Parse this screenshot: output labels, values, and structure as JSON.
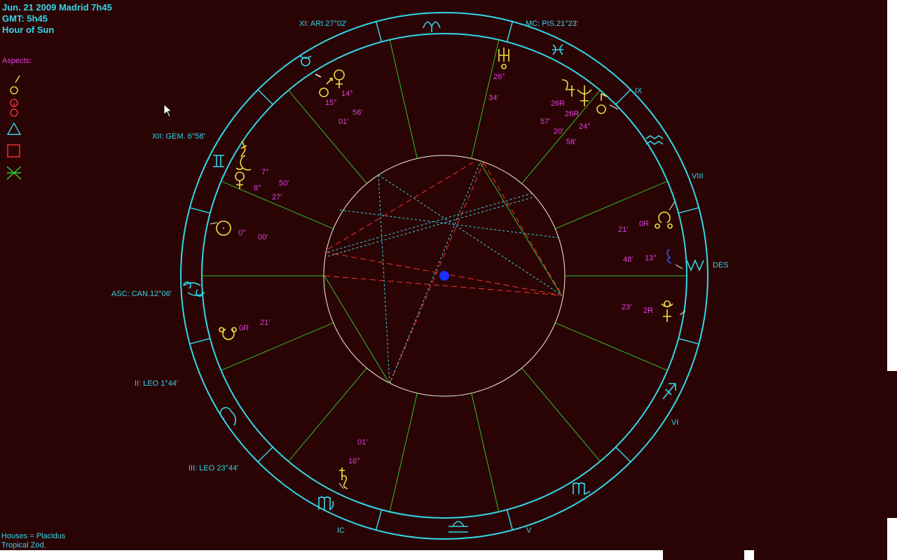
{
  "header": {
    "line1": "Jun. 21 2009 Madrid  7h45",
    "line2": "GMT: 5h45",
    "line3": "Hour of Sun"
  },
  "aspects": {
    "title": "Aspects:",
    "items": [
      {
        "name": "conjunction",
        "color": "#f0e040"
      },
      {
        "name": "opposition",
        "color": "#ff3030"
      },
      {
        "name": "trine",
        "color": "#33d6ea"
      },
      {
        "name": "square",
        "color": "#ff3030"
      },
      {
        "name": "sextile",
        "color": "#30d030"
      }
    ]
  },
  "footer": {
    "houses": "Houses = Placidus",
    "zodiac": "Tropical Zod."
  },
  "colors": {
    "background": "#2a0404",
    "wheel": "#33d6ea",
    "house_lines": "#2fc02f",
    "inner_circle": "#f2f2e0",
    "planet": "#f0e040",
    "degree_text": "#e040e0",
    "opposition": "#ff3030",
    "trine": "#33d6ea",
    "center_dot": "#1830ff",
    "moon_node_blue": "#3050ff"
  },
  "house_cusps": {
    "xi": "XI: ARI.27°02'",
    "mc": "MC: PIS.21°23'",
    "xii": "XII: GEM. 6°58'",
    "asc": "ASC: CAN.12°06'",
    "ii": "II: LEO  1°44'",
    "iii": "III: LEO 23°44'",
    "ic": "IC",
    "v": "V",
    "vi": "VI",
    "des": "DES",
    "viii": "VIII",
    "ix": "IX"
  },
  "degrees": {
    "mars_deg": "15°",
    "mars_min": "01'",
    "venus_deg": "14°",
    "venus_min": "56'",
    "uranus_deg": "26°",
    "uranus_min": "34'",
    "jupiter_deg": "26R",
    "jupiter_min": "57'",
    "neptune_deg": "26R",
    "neptune_min": "20'",
    "chiron_deg": "24°",
    "chiron_min": "58'",
    "moon_deg": "7°",
    "moon_min": "50'",
    "mercury_deg": "8°",
    "mercury_min": "27'",
    "sun_deg": "0°",
    "sun_min": "00'",
    "node_deg": "0R",
    "node_min": "21'",
    "snode_deg": "0R",
    "snode_min": "21'",
    "lilith_deg": "13°",
    "lilith_min": "48'",
    "pluto_deg": "2R",
    "pluto_min": "23'",
    "saturn_deg": "16°",
    "saturn_min": "01'"
  }
}
